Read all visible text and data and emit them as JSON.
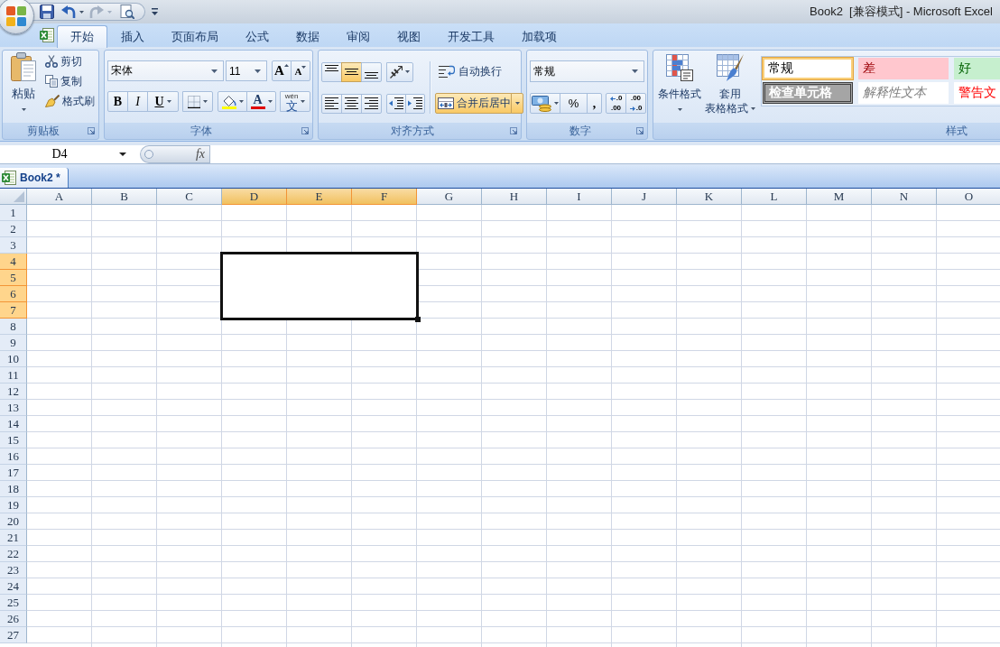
{
  "window": {
    "title": "Book2  [兼容模式] - Microsoft Excel"
  },
  "ribbon_tabs": [
    {
      "label": "开始",
      "selected": true
    },
    {
      "label": "插入",
      "selected": false
    },
    {
      "label": "页面布局",
      "selected": false
    },
    {
      "label": "公式",
      "selected": false
    },
    {
      "label": "数据",
      "selected": false
    },
    {
      "label": "审阅",
      "selected": false
    },
    {
      "label": "视图",
      "selected": false
    },
    {
      "label": "开发工具",
      "selected": false
    },
    {
      "label": "加载项",
      "selected": false
    }
  ],
  "ribbon": {
    "clipboard": {
      "label": "剪贴板",
      "paste": "粘贴",
      "items": [
        {
          "kind": "cut",
          "label": "剪切"
        },
        {
          "kind": "copy",
          "label": "复制"
        },
        {
          "kind": "format_painter",
          "label": "格式刷"
        }
      ]
    },
    "font": {
      "label": "字体",
      "font_name": "宋体",
      "font_size": "11",
      "grow": "A",
      "shrink": "A",
      "bold": "B",
      "italic": "I",
      "underline": "U",
      "font_color": "A",
      "phonetic": "文",
      "phonetic_ruby": "wén"
    },
    "alignment": {
      "label": "对齐方式",
      "vertical": [
        {
          "kind": "top",
          "selected": false
        },
        {
          "kind": "middle",
          "selected": true
        },
        {
          "kind": "bottom",
          "selected": false
        }
      ],
      "horizontal": [
        {
          "kind": "left",
          "selected": false
        },
        {
          "kind": "center",
          "selected": false
        },
        {
          "kind": "right",
          "selected": false
        }
      ],
      "wrap_text": {
        "label": "自动换行",
        "selected": false
      },
      "merge_center": {
        "label": "合并后居中",
        "selected": true
      }
    },
    "number": {
      "label": "数字",
      "format": "常规",
      "percent": "%",
      "comma": ",",
      "decimals": [
        {
          "kind": "increase",
          "top": ".0",
          "bottom": ".00"
        },
        {
          "kind": "decrease",
          "top": ".00",
          "bottom": ".0"
        }
      ]
    },
    "styles": {
      "label": "样式",
      "conditional_format": "条件格式",
      "table_format": [
        "套用",
        "表格格式"
      ],
      "cell_styles": [
        {
          "label": "常规",
          "kind": "normal",
          "selected": true
        },
        {
          "label": "差",
          "kind": "bad",
          "selected": false
        },
        {
          "label": "好",
          "kind": "good",
          "selected": false
        },
        {
          "label": "检查单元格",
          "kind": "check",
          "selected": false
        },
        {
          "label": "解释性文本",
          "kind": "explanatory",
          "selected": false
        },
        {
          "label": "警告文",
          "kind": "warning",
          "selected": false
        }
      ]
    }
  },
  "formula_bar": {
    "name_box": "D4",
    "function_label": "fx"
  },
  "workbook_tabs": [
    {
      "label": "Book2 *",
      "selected": true
    }
  ],
  "sheet": {
    "columns": [
      {
        "label": "A",
        "selected": false
      },
      {
        "label": "B",
        "selected": false
      },
      {
        "label": "C",
        "selected": false
      },
      {
        "label": "D",
        "selected": true
      },
      {
        "label": "E",
        "selected": true
      },
      {
        "label": "F",
        "selected": true
      },
      {
        "label": "G",
        "selected": false
      },
      {
        "label": "H",
        "selected": false
      },
      {
        "label": "I",
        "selected": false
      },
      {
        "label": "J",
        "selected": false
      },
      {
        "label": "K",
        "selected": false
      },
      {
        "label": "L",
        "selected": false
      },
      {
        "label": "M",
        "selected": false
      },
      {
        "label": "N",
        "selected": false
      },
      {
        "label": "O",
        "selected": false
      }
    ],
    "rows": [
      {
        "label": "1",
        "selected": false
      },
      {
        "label": "2",
        "selected": false
      },
      {
        "label": "3",
        "selected": false
      },
      {
        "label": "4",
        "selected": true
      },
      {
        "label": "5",
        "selected": true
      },
      {
        "label": "6",
        "selected": true
      },
      {
        "label": "7",
        "selected": true
      },
      {
        "label": "8",
        "selected": false
      },
      {
        "label": "9",
        "selected": false
      },
      {
        "label": "10",
        "selected": false
      },
      {
        "label": "11",
        "selected": false
      },
      {
        "label": "12",
        "selected": false
      },
      {
        "label": "13",
        "selected": false
      },
      {
        "label": "14",
        "selected": false
      },
      {
        "label": "15",
        "selected": false
      },
      {
        "label": "16",
        "selected": false
      },
      {
        "label": "17",
        "selected": false
      },
      {
        "label": "18",
        "selected": false
      },
      {
        "label": "19",
        "selected": false
      },
      {
        "label": "20",
        "selected": false
      },
      {
        "label": "21",
        "selected": false
      },
      {
        "label": "22",
        "selected": false
      },
      {
        "label": "23",
        "selected": false
      },
      {
        "label": "24",
        "selected": false
      },
      {
        "label": "25",
        "selected": false
      },
      {
        "label": "26",
        "selected": false
      },
      {
        "label": "27",
        "selected": false
      }
    ]
  }
}
